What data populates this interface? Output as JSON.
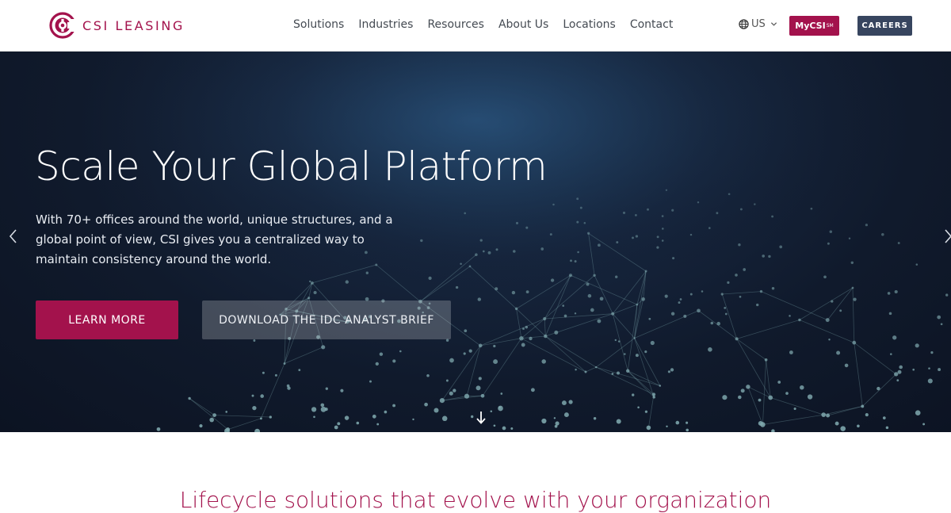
{
  "brand": {
    "name": "CSI LEASING",
    "color": "#a3124c"
  },
  "nav": {
    "items": [
      {
        "label": "Solutions"
      },
      {
        "label": "Industries"
      },
      {
        "label": "Resources"
      },
      {
        "label": "About Us"
      },
      {
        "label": "Locations"
      },
      {
        "label": "Contact"
      }
    ]
  },
  "utility": {
    "region_label": "US",
    "region_icon": "globe-icon",
    "mycsi_label": "MyCSI",
    "mycsi_superscript": "SM",
    "careers_label": "CAREERS"
  },
  "hero": {
    "title": "Scale Your Global Platform",
    "subtitle": "With 70+ offices around the world, unique structures, and a global point of view, CSI gives you a centralized way to maintain consistency around the world.",
    "primary_cta": "LEARN MORE",
    "secondary_cta": "DOWNLOAD THE IDC ANALYST BRIEF",
    "prev_icon": "chevron-left-icon",
    "next_icon": "chevron-right-icon",
    "scroll_icon": "arrow-down-icon"
  },
  "section": {
    "title": "Lifecycle solutions that evolve with your organization"
  },
  "colors": {
    "accent": "#a3124c",
    "careers": "#37455f",
    "hero_bg": "#101a2c",
    "network": "#6f9aa3"
  }
}
